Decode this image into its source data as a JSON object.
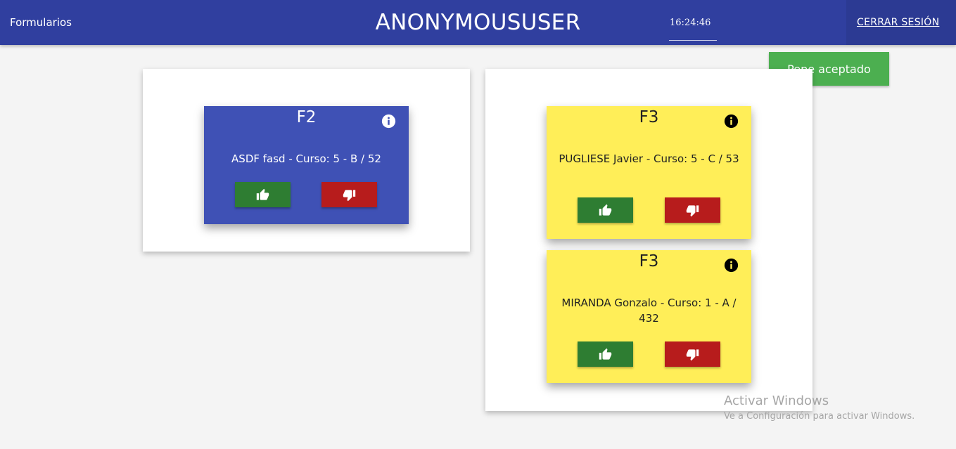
{
  "header": {
    "brand": "Formularios",
    "user": "ANONYMOUSUSER",
    "time": "16:24:46",
    "logout": "CERRAR SESIÓN"
  },
  "toast": {
    "text": "Pepe aceptado",
    "color": "#4caf50"
  },
  "colors": {
    "header": "#303f9f",
    "card_blue": "#3f51b5",
    "card_yellow": "#ffee58",
    "approve": "#2e7d32",
    "reject": "#b71c1c"
  },
  "left_panel": {
    "cards": [
      {
        "title": "F2",
        "body": "ASDF fasd - Curso: 5 - B / 52",
        "color": "blue"
      }
    ]
  },
  "right_panel": {
    "cards": [
      {
        "title": "F3",
        "body": "PUGLIESE Javier - Curso: 5 - C / 53",
        "color": "yellow"
      },
      {
        "title": "F3",
        "body": "MIRANDA Gonzalo - Curso: 1 - A / 432",
        "color": "yellow"
      }
    ]
  },
  "icons": {
    "info": "info-icon",
    "approve": "thumbs-up-icon",
    "reject": "thumbs-down-icon"
  },
  "watermark": {
    "title": "Activar Windows",
    "subtitle": "Ve a Configuración para activar Windows."
  }
}
